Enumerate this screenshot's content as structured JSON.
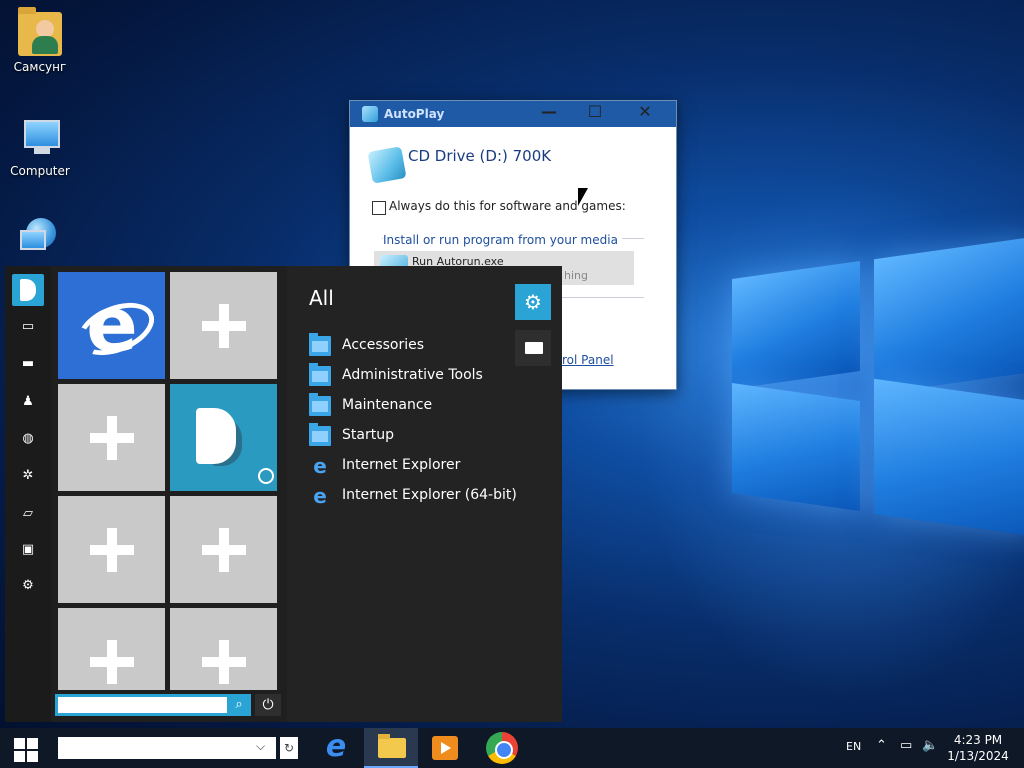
{
  "desktop": {
    "icons": [
      {
        "label": "Самсунг",
        "icon": "user-folder-icon"
      },
      {
        "label": "Computer",
        "icon": "computer-icon"
      },
      {
        "label": "",
        "icon": "network-globe-icon"
      }
    ]
  },
  "autoplay": {
    "title": "AutoPlay",
    "drive": "CD Drive (D:) 700K",
    "always_label": "Always do this for software and games:",
    "section": "Install or run program from your media",
    "run_label": "Run Autorun.exe",
    "run_sub": "hing",
    "link": "rol Panel",
    "controls": {
      "minimize": "—",
      "maximize": "☐",
      "close": "✕"
    }
  },
  "start_menu": {
    "all_label": "All",
    "programs": [
      {
        "label": "Accessories",
        "icon": "folder-icon"
      },
      {
        "label": "Administrative Tools",
        "icon": "folder-icon"
      },
      {
        "label": "Maintenance",
        "icon": "folder-icon"
      },
      {
        "label": "Startup",
        "icon": "folder-icon"
      },
      {
        "label": "Internet Explorer",
        "icon": "ie-icon"
      },
      {
        "label": "Internet Explorer (64-bit)",
        "icon": "ie-icon"
      }
    ],
    "rail": [
      "monitor-icon",
      "folder-icon",
      "users-icon",
      "globe-icon",
      "settings-icon",
      "chart-icon",
      "display-icon",
      "gear-icon"
    ],
    "search_placeholder": ""
  },
  "taskbar": {
    "language": "EN",
    "time": "4:23 PM",
    "date": "1/13/2024",
    "search_value": ""
  },
  "colors": {
    "accent": "#2aa4d4",
    "taskbar": "#0e1826"
  }
}
